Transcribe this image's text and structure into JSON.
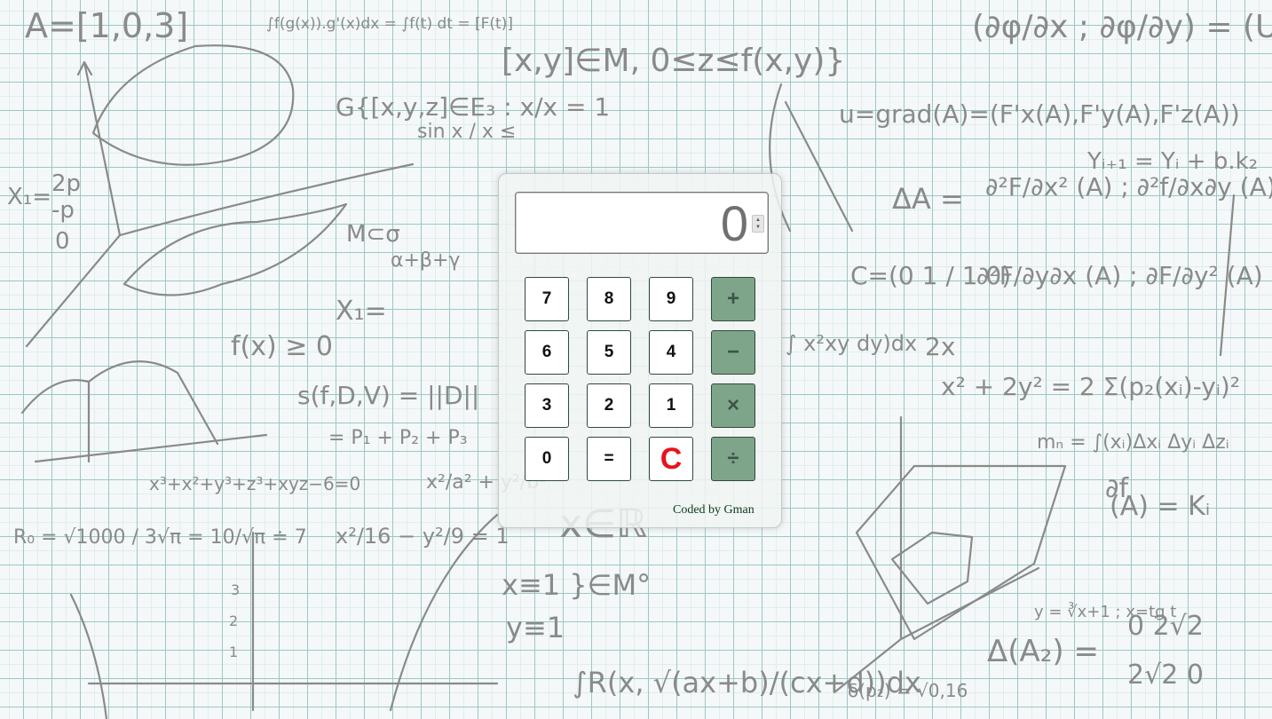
{
  "calculator": {
    "display_value": "0",
    "buttons": [
      {
        "label": "7",
        "type": "digit"
      },
      {
        "label": "8",
        "type": "digit"
      },
      {
        "label": "9",
        "type": "digit"
      },
      {
        "label": "+",
        "type": "operator"
      },
      {
        "label": "6",
        "type": "digit"
      },
      {
        "label": "5",
        "type": "digit"
      },
      {
        "label": "4",
        "type": "digit"
      },
      {
        "label": "−",
        "type": "operator"
      },
      {
        "label": "3",
        "type": "digit"
      },
      {
        "label": "2",
        "type": "digit"
      },
      {
        "label": "1",
        "type": "digit"
      },
      {
        "label": "×",
        "type": "operator"
      },
      {
        "label": "0",
        "type": "digit"
      },
      {
        "label": "=",
        "type": "equals"
      },
      {
        "label": "C",
        "type": "clear"
      },
      {
        "label": "÷",
        "type": "operator"
      }
    ],
    "credit": "Coded by Gman",
    "colors": {
      "operator_bg": "#7ea58a",
      "clear_text": "#e8131a",
      "display_text": "#707070"
    }
  }
}
